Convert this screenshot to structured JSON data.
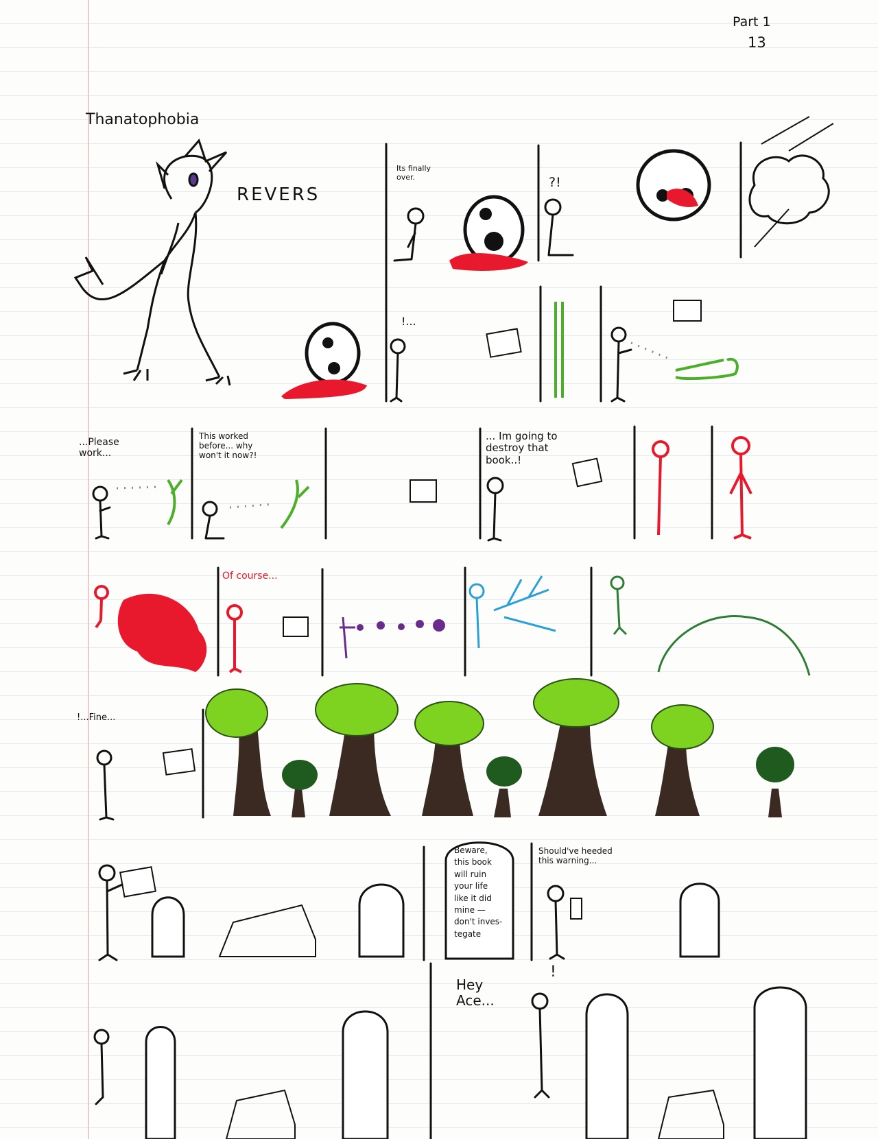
{
  "header": {
    "part": "Part 1",
    "page": "13"
  },
  "title": "Thanatophobia",
  "sfx": {
    "revers": "REVERS"
  },
  "row1": {
    "dialogue_over": "Its finally\nover.",
    "exclaim": "?!"
  },
  "row2": {
    "exclaim": "!..."
  },
  "row3": {
    "please_work": "...Please\nwork...",
    "worked_before": "This worked\nbefore... why\nwon't it now?!",
    "destroy_book": "... Im going to\ndestroy that\nbook..!"
  },
  "row4": {
    "of_course": "Of course..."
  },
  "row5": {
    "fine": "!...Fine..."
  },
  "row6": {
    "gravestone_text": "Beware,\nthis book\nwill ruin\nyour life\nlike it did\nmine —\ndon't inves-\ntegate",
    "heeded": "Should've heeded\nthis warning..."
  },
  "row7": {
    "hey_ace": "Hey\nAce...",
    "exclaim": "!"
  },
  "colors": {
    "blood": "#e8192c",
    "revive_green": "#4caf2a",
    "ink": "#111111",
    "ice_blue": "#2a9fd8",
    "void_purple": "#6a2c8c",
    "leaf": "#7ed321",
    "trunk": "#3a2a22"
  }
}
